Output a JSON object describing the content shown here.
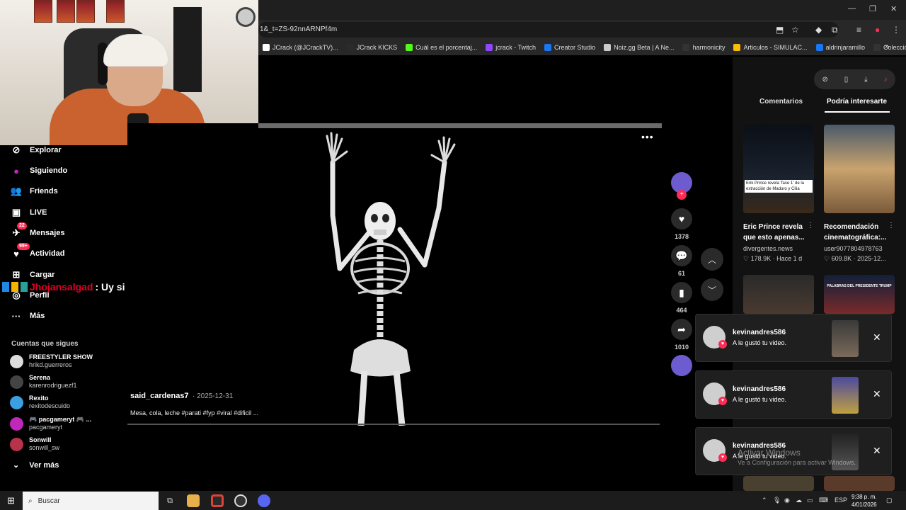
{
  "browser": {
    "url": "1&_t=ZS-92nnARNPf4m",
    "bookmarks": [
      {
        "label": "JCrack (@JCrackTV)...",
        "color": "#ffffff"
      },
      {
        "label": "JCrack KICKS",
        "color": "#2b2b2b"
      },
      {
        "label": "Cuál es el porcentaj...",
        "color": "#53fc18"
      },
      {
        "label": "jcrack - Twitch",
        "color": "#9146ff"
      },
      {
        "label": "Creator Studio",
        "color": "#1877f2"
      },
      {
        "label": "Noiz.gg Beta | A Ne...",
        "color": "#cccccc"
      },
      {
        "label": "harmonicity",
        "color": "#333333"
      },
      {
        "label": "Articulos - SIMULAC...",
        "color": "#fbbc04"
      },
      {
        "label": "aldrinjaramillo",
        "color": "#1877f2"
      },
      {
        "label": "Colección de M_blei...",
        "color": "#333333"
      }
    ]
  },
  "sidebar": {
    "items": [
      {
        "label": "Explorar",
        "icon": "compass-icon"
      },
      {
        "label": "Siguiendo",
        "icon": "following-icon"
      },
      {
        "label": "Friends",
        "icon": "friends-icon"
      },
      {
        "label": "LIVE",
        "icon": "live-icon"
      },
      {
        "label": "Mensajes",
        "icon": "messages-icon",
        "badge": "22"
      },
      {
        "label": "Actividad",
        "icon": "activity-icon",
        "badge": "99+"
      },
      {
        "label": "Cargar",
        "icon": "upload-icon"
      },
      {
        "label": "Perfil",
        "icon": "profile-icon"
      },
      {
        "label": "Más",
        "icon": "more-icon"
      }
    ],
    "following_title": "Cuentas que sigues",
    "following": [
      {
        "name": "FREESTYLER SHOW",
        "handle": "hrikd.guerreros",
        "color": "#dddddd"
      },
      {
        "name": "Serena",
        "handle": "karenrodriguezf1",
        "color": "#444444"
      },
      {
        "name": "Rexito",
        "handle": "rexitodescuido",
        "color": "#3aa0e0"
      },
      {
        "name": "🎮 pacgameryt 🎮 ...",
        "handle": "pacgameryt",
        "color": "#c028b9"
      },
      {
        "name": "Sonwill",
        "handle": "sonwill_sw",
        "color": "#b8324a"
      }
    ],
    "see_more": "Ver más"
  },
  "chat_overlay": {
    "user": "Jhojansalgad",
    "message": ": Uy si"
  },
  "video": {
    "author": "said_cardenas7",
    "date": "· 2025-12-31",
    "caption": "Mesa, cola, leche #parati #fyp #viral #dificil ..."
  },
  "actions": {
    "likes": "1378",
    "comments": "61",
    "saves": "464",
    "shares": "1010"
  },
  "right_panel": {
    "tabs": [
      "Comentarios",
      "Podría interesarte"
    ],
    "recommendations": [
      {
        "title": "Eric Prince revela que esto apenas...",
        "source": "divergentes.news",
        "views": "178.9K",
        "time": "· Hace 1 d",
        "overlay": "Erik Prince revela 'fase 1' de la extracción de Maduro y Cilia"
      },
      {
        "title": "Recomendación cinematográfica:...",
        "source": "user9077804978763",
        "views": "609.8K",
        "time": "· 2025-12...",
        "overlay": ""
      },
      {
        "title": "",
        "source": "",
        "views": "",
        "time": "",
        "overlay": ""
      },
      {
        "title": "",
        "source": "",
        "views": "",
        "time": "",
        "overlay": "PALABRAS DEL PRESIDENTE TRUMP"
      }
    ]
  },
  "notifications": [
    {
      "user": "kevinandres586",
      "message": "A le gustó tu video."
    },
    {
      "user": "kevinandres586",
      "message": "A le gustó tu video."
    },
    {
      "user": "kevinandres586",
      "message": "A le gustó tu video."
    }
  ],
  "watermark": {
    "title": "Activar Windows",
    "subtitle": "Ve a Configuración para activar Windows."
  },
  "taskbar": {
    "search_placeholder": "Buscar",
    "lang": "ESP",
    "time": "9:38 p. m.",
    "date": "4/01/2026"
  }
}
